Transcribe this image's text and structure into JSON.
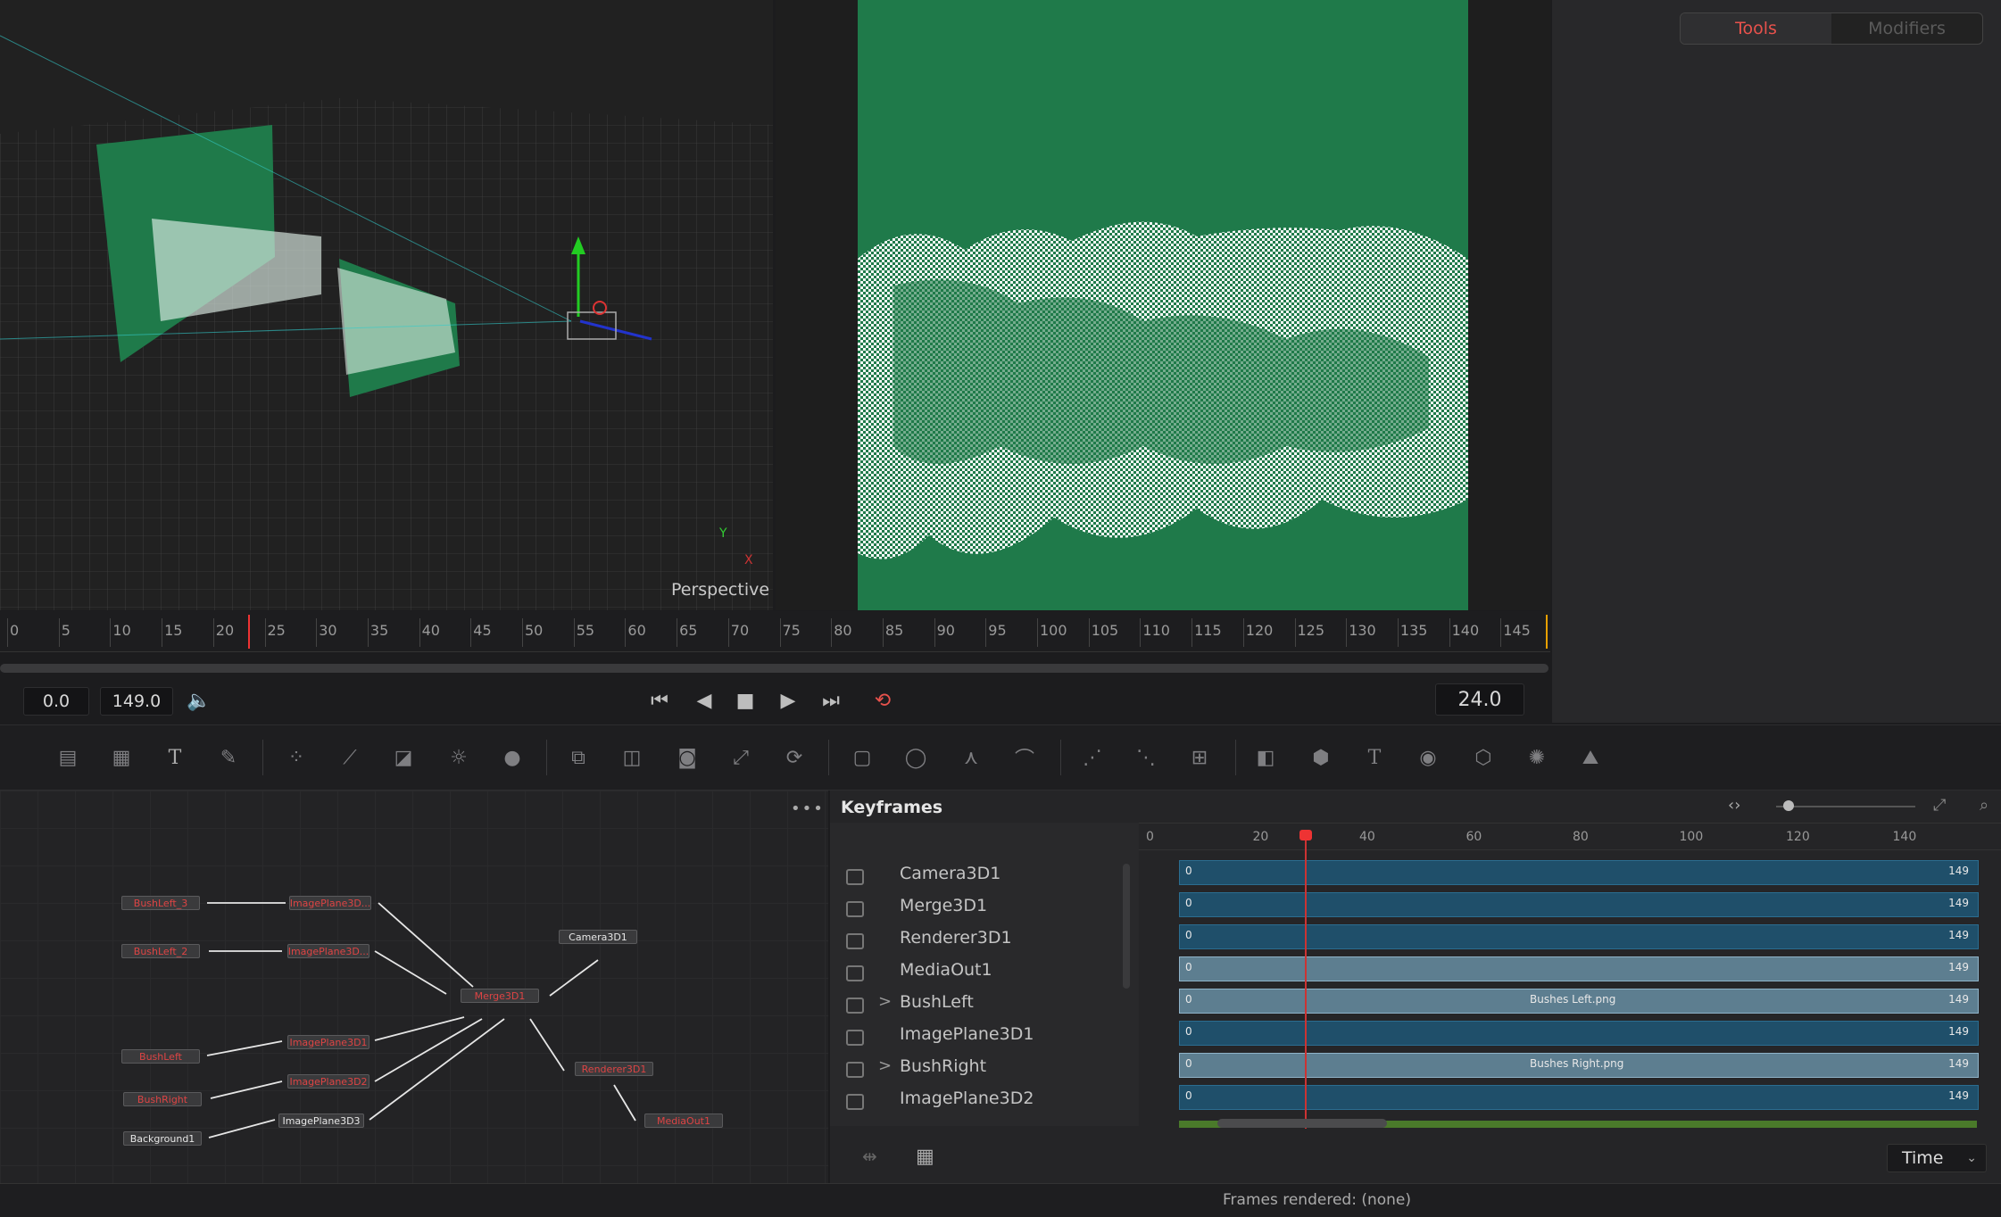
{
  "viewer3d": {
    "view_label": "Perspective",
    "axis_y": "Y",
    "axis_x": "X"
  },
  "inspector": {
    "tabs": [
      "Tools",
      "Modifiers"
    ]
  },
  "ruler": {
    "labels": [
      "0",
      "5",
      "10",
      "15",
      "20",
      "25",
      "30",
      "35",
      "40",
      "45",
      "50",
      "55",
      "60",
      "65",
      "70",
      "75",
      "80",
      "85",
      "90",
      "95",
      "100",
      "105",
      "110",
      "115",
      "120",
      "125",
      "130",
      "135",
      "140",
      "145"
    ]
  },
  "transport": {
    "start": "0.0",
    "end": "149.0",
    "fps": "24.0"
  },
  "nodes": {
    "bushleft3": "BushLeft_3",
    "bushleft2": "BushLeft_2",
    "bushleft": "BushLeft",
    "bushright": "BushRight",
    "background": "Background1",
    "imgplane_a": "ImagePlane3D...",
    "imgplane_b": "ImagePlane3D...",
    "imgplane1": "ImagePlane3D1",
    "imgplane2": "ImagePlane3D2",
    "imgplane3": "ImagePlane3D3",
    "merge": "Merge3D1",
    "camera": "Camera3D1",
    "renderer": "Renderer3D1",
    "mediaout": "MediaOut1"
  },
  "keyframes": {
    "title": "Keyframes",
    "ruler": [
      "0",
      "20",
      "40",
      "60",
      "80",
      "100",
      "120",
      "140"
    ],
    "rows": [
      {
        "name": "Camera3D1",
        "expand": "",
        "start": "0",
        "end": "149",
        "clip": ""
      },
      {
        "name": "Merge3D1",
        "expand": "",
        "start": "0",
        "end": "149",
        "clip": ""
      },
      {
        "name": "Renderer3D1",
        "expand": "",
        "start": "0",
        "end": "149",
        "clip": ""
      },
      {
        "name": "MediaOut1",
        "expand": "",
        "start": "0",
        "end": "149",
        "clip": ""
      },
      {
        "name": "BushLeft",
        "expand": ">",
        "start": "0",
        "end": "149",
        "clip": "Bushes Left.png"
      },
      {
        "name": "ImagePlane3D1",
        "expand": "",
        "start": "0",
        "end": "149",
        "clip": ""
      },
      {
        "name": "BushRight",
        "expand": ">",
        "start": "0",
        "end": "149",
        "clip": "Bushes Right.png"
      },
      {
        "name": "ImagePlane3D2",
        "expand": "",
        "start": "0",
        "end": "149",
        "clip": ""
      }
    ],
    "mode": "Time"
  },
  "status": {
    "text": "Frames rendered: (none)"
  },
  "colors": {
    "accent": "#e8524c",
    "green": "#1f7a4a",
    "track": "#1f4f6a"
  }
}
